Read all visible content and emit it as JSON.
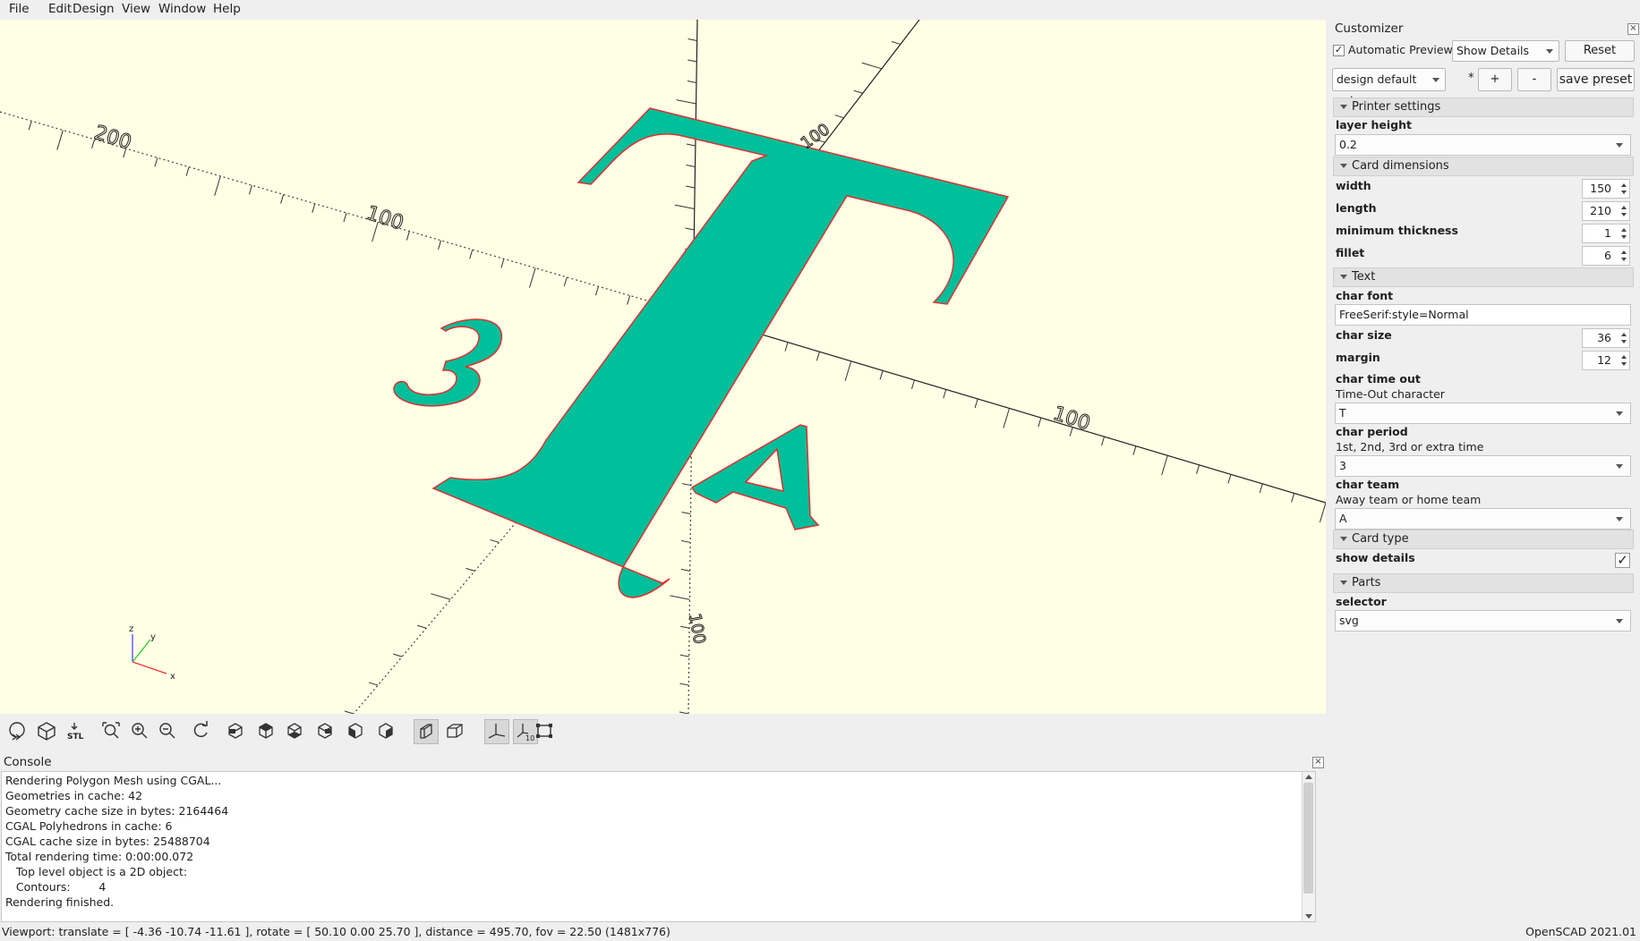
{
  "menu": [
    "File",
    "Edit",
    "Design",
    "View",
    "Window",
    "Help"
  ],
  "viewport": {
    "axis_labels": {
      "x": "x",
      "y": "y",
      "z": "z"
    },
    "scale_labels": [
      "200",
      "100",
      "100",
      "100",
      "100"
    ],
    "model_chars": [
      "T",
      "3",
      "A"
    ],
    "colors": {
      "background": "#ffffe5",
      "fill": "#00bf9a",
      "outline": "#e03030"
    }
  },
  "toolbar": {
    "icons": [
      "preview-icon",
      "render-icon",
      "export-stl-icon",
      "view-all-icon",
      "zoom-in-icon",
      "zoom-out-icon",
      "reset-view-icon",
      "view-right-icon",
      "view-top-icon",
      "view-bottom-icon",
      "view-left-icon",
      "view-front-icon",
      "view-back-icon",
      "perspective-icon",
      "orthogonal-icon",
      "show-axes-icon",
      "show-scale-markers-icon",
      "show-edges-icon"
    ],
    "stl_label": "STL",
    "scale_label": "10"
  },
  "console": {
    "title": "Console",
    "lines": [
      "Rendering Polygon Mesh using CGAL...",
      "Geometries in cache: 42",
      "Geometry cache size in bytes: 2164464",
      "CGAL Polyhedrons in cache: 6",
      "CGAL cache size in bytes: 25488704",
      "Total rendering time: 0:00:00.072",
      "   Top level object is a 2D object:",
      "   Contours:        4",
      "Rendering finished."
    ]
  },
  "status": {
    "left": "Viewport: translate = [ -4.36 -10.74 -11.61 ], rotate = [ 50.10 0.00 25.70 ], distance = 495.70, fov = 22.50 (1481x776)",
    "right": "OpenSCAD 2021.01"
  },
  "customizer": {
    "title": "Customizer",
    "automatic_preview": "Automatic Preview",
    "automatic_preview_checked": true,
    "show_details": "Show Details",
    "reset": "Reset",
    "preset": "design default values",
    "modified": "*",
    "plus": "+",
    "minus": "-",
    "save_preset": "save preset",
    "sections": {
      "printer": "Printer settings",
      "card": "Card dimensions",
      "text": "Text",
      "type": "Card type",
      "parts": "Parts"
    },
    "params": {
      "layer_height": {
        "label": "layer height",
        "value": "0.2"
      },
      "width": {
        "label": "width",
        "value": "150"
      },
      "length": {
        "label": "length",
        "value": "210"
      },
      "min_thickness": {
        "label": "minimum thickness",
        "value": "1"
      },
      "fillet": {
        "label": "fillet",
        "value": "6"
      },
      "char_font": {
        "label": "char font",
        "value": "FreeSerif:style=Normal"
      },
      "char_size": {
        "label": "char size",
        "value": "36"
      },
      "margin": {
        "label": "margin",
        "value": "12"
      },
      "char_time_out": {
        "label": "char time out",
        "desc": "Time-Out character",
        "value": "T"
      },
      "char_period": {
        "label": "char period",
        "desc": "1st, 2nd, 3rd or extra time",
        "value": "3"
      },
      "char_team": {
        "label": "char team",
        "desc": "Away team or home team",
        "value": "A"
      },
      "show_details": {
        "label": "show details",
        "checked": true
      },
      "selector": {
        "label": "selector",
        "value": "svg"
      }
    }
  }
}
